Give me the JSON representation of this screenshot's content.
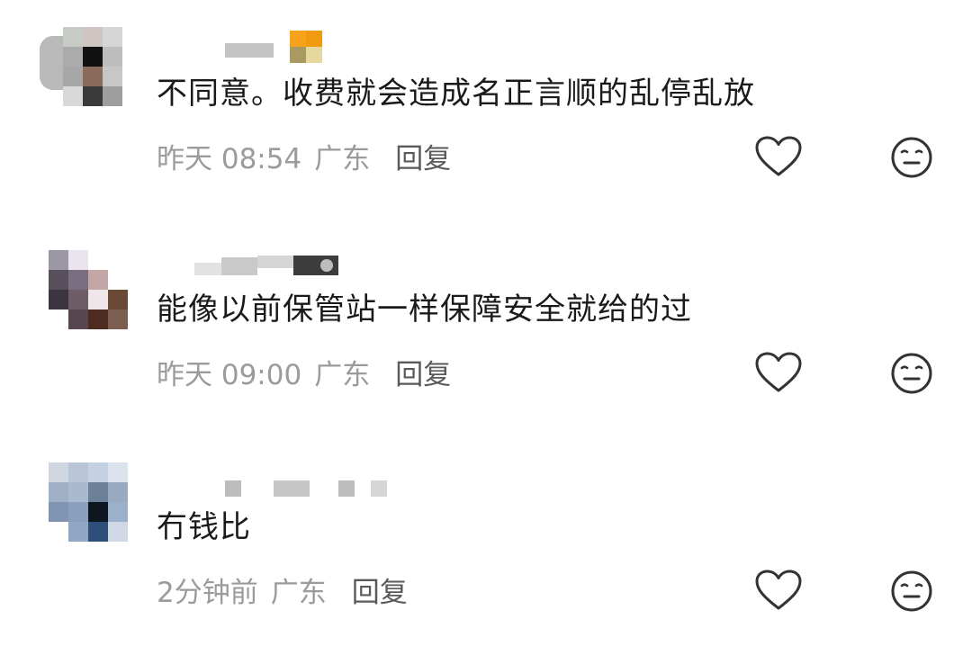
{
  "comments": [
    {
      "text": "不同意。收费就会造成名正言顺的乱停乱放",
      "time": "昨天 08:54",
      "location": "广东",
      "reply_label": "回复",
      "badge_colors": [
        "#f6a21a",
        "#e8c04a"
      ]
    },
    {
      "text": "能像以前保管站一样保障安全就给的过",
      "time": "昨天 09:00",
      "location": "广东",
      "reply_label": "回复"
    },
    {
      "text": "冇钱比",
      "time": "2分钟前",
      "location": "广东",
      "reply_label": "回复"
    }
  ],
  "icons": {
    "like": "heart-outline-icon",
    "dislike": "neutral-face-icon"
  },
  "colors": {
    "primary_text": "#1a1a1a",
    "meta_text": "#9b9b9b",
    "reply_text": "#5a5a5a",
    "icon_stroke": "#333333"
  }
}
